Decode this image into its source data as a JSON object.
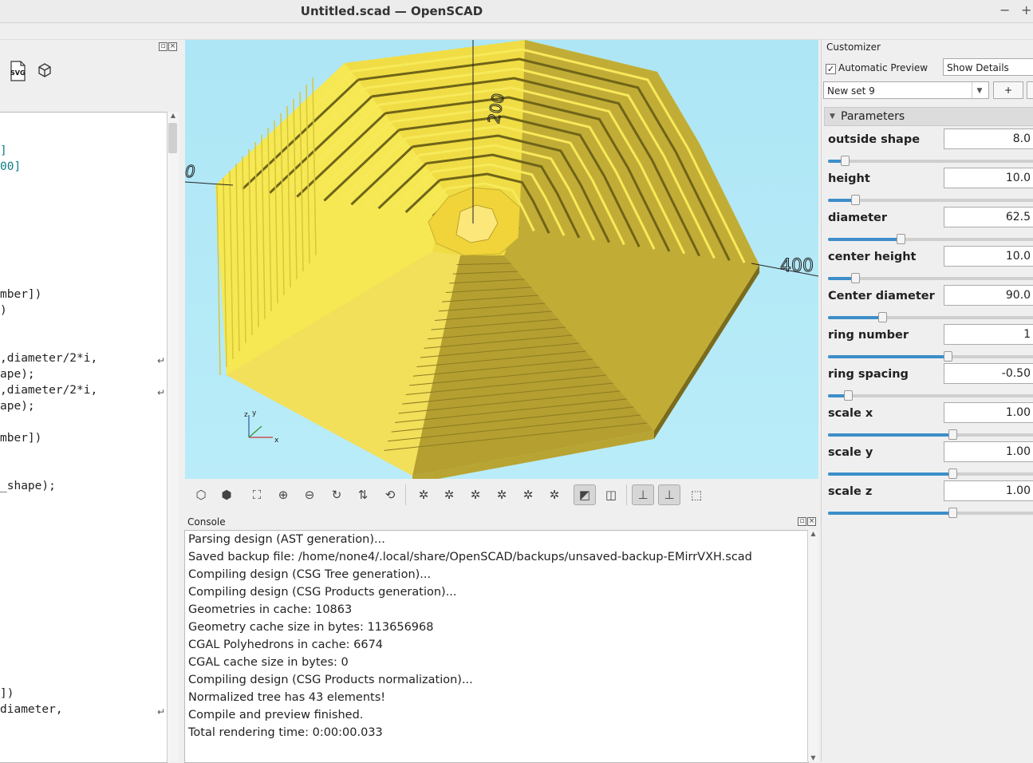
{
  "window": {
    "title": "Untitled.scad — OpenSCAD",
    "minimize_glyph": "−",
    "maximize_glyph": "+"
  },
  "editor": {
    "toolbar_icons": [
      "export-svg-icon",
      "export-stl-icon"
    ],
    "svg_label": "SVG",
    "lines": [
      {
        "text": "]",
        "teal": true
      },
      {
        "text": "00]",
        "teal": true
      },
      {
        "text": "mber])"
      },
      {
        "text": ")"
      },
      {
        "text": ",diameter/2*i,"
      },
      {
        "text": "ape);"
      },
      {
        "text": ",diameter/2*i,"
      },
      {
        "text": "ape);"
      },
      {
        "text": "mber])"
      },
      {
        "text": "_shape);"
      },
      {
        "text": "])"
      },
      {
        "text": "diameter,"
      }
    ]
  },
  "viewport": {
    "axis_label_top": "200",
    "axis_label_left": "0",
    "axis_label_right": "400",
    "colors": {
      "background": "#b3e9f7",
      "model_face": "#f4e44a",
      "model_dark": "#b8a432",
      "model_shade": "#7a6c1c"
    }
  },
  "view_toolbar": {
    "buttons": [
      "preview-icon",
      "render-icon",
      "view-all-icon",
      "zoom-in-icon",
      "zoom-out-icon",
      "reset-view-icon",
      "view-top-bottom-icon",
      "view-diagonal-icon",
      "view-right-icon",
      "view-left-icon",
      "view-front-icon",
      "view-back-icon",
      "view-top-icon",
      "view-bottom-icon",
      "perspective-icon",
      "orthogonal-icon",
      "show-axes-icon",
      "show-scale-icon",
      "show-edges-icon"
    ]
  },
  "console": {
    "title": "Console",
    "lines": [
      "Parsing design (AST generation)...",
      "Saved backup file: /home/none4/.local/share/OpenSCAD/backups/unsaved-backup-EMirrVXH.scad",
      "Compiling design (CSG Tree generation)...",
      "Compiling design (CSG Products generation)...",
      "Geometries in cache: 10863",
      "Geometry cache size in bytes: 113656968",
      "CGAL Polyhedrons in cache: 6674",
      "CGAL cache size in bytes: 0",
      "Compiling design (CSG Products normalization)...",
      "Normalized tree has 43 elements!",
      "Compile and preview finished.",
      "Total rendering time: 0:00:00.033"
    ]
  },
  "customizer": {
    "title": "Customizer",
    "automatic_preview_label": "Automatic Preview",
    "automatic_preview_checked": true,
    "details_select": "Show Details",
    "preset_select": "New set 9",
    "add_preset_label": "+",
    "section_label": "Parameters",
    "accent_color": "#3d8ec9",
    "params": [
      {
        "name": "outside shape",
        "value": "8.0",
        "fraction": 0.077
      },
      {
        "name": "height",
        "value": "10.0",
        "fraction": 0.125
      },
      {
        "name": "diameter",
        "value": "62.5",
        "fraction": 0.337
      },
      {
        "name": "center height",
        "value": "10.0",
        "fraction": 0.125
      },
      {
        "name": "Center diameter",
        "value": "90.0",
        "fraction": 0.25
      },
      {
        "name": "ring number",
        "value": "1",
        "fraction": 0.556
      },
      {
        "name": "ring spacing",
        "value": "-0.50",
        "fraction": 0.092
      },
      {
        "name": "scale x",
        "value": "1.00",
        "fraction": 0.578
      },
      {
        "name": "scale y",
        "value": "1.00",
        "fraction": 0.578
      },
      {
        "name": "scale z",
        "value": "1.00",
        "fraction": 0.578
      }
    ]
  }
}
